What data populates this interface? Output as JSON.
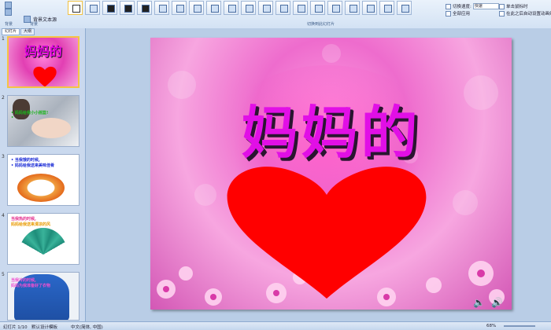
{
  "ribbon": {
    "left_items": [
      "",
      "",
      "背景文本源"
    ],
    "group_labels": {
      "left": "背景",
      "mid": "背景",
      "themes": "切换到此幻灯片"
    },
    "transition_thumbs": 22,
    "speed_label": "切换速度:",
    "speed_value": "快速",
    "apply_all": "全部应用",
    "on_click": "单击鼠标时",
    "auto_after": "在此之后自动设置动画效果"
  },
  "left_pane": {
    "tabs": [
      "幻灯片",
      "大纲"
    ],
    "slides": [
      {
        "num": "1",
        "title": "妈妈的"
      },
      {
        "num": "2",
        "lines": [
          "• 妈妈给我小小摇篮!",
          "•",
          ""
        ]
      },
      {
        "num": "3",
        "lines": [
          "• 当我饿的时候,",
          "• 妈妈给我送来美味佳肴"
        ]
      },
      {
        "num": "4",
        "lines": [
          "当我热的时候,",
          "妈妈给我送来清凉的风"
        ]
      },
      {
        "num": "5",
        "lines": [
          "当我冷的时候,",
          "妈妈为我准备好了衣物"
        ]
      }
    ]
  },
  "slide": {
    "title": "妈妈的",
    "heart_color": "#ff0000",
    "title_color": "#e10fe6"
  },
  "status": {
    "slide_count": "幻灯片 1/10",
    "theme": "默认设计模板",
    "language": "中文(简体, 中国)",
    "zoom": "68%"
  }
}
